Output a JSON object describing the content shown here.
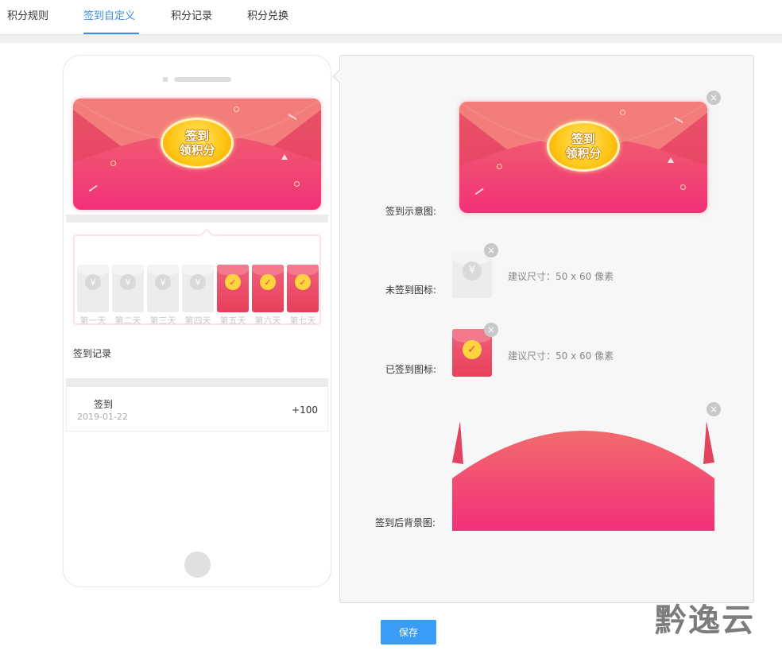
{
  "tabs": [
    {
      "label": "积分规则",
      "active": false
    },
    {
      "label": "签到自定义",
      "active": true
    },
    {
      "label": "积分记录",
      "active": false
    },
    {
      "label": "积分兑换",
      "active": false
    }
  ],
  "banner": {
    "line1": "签到",
    "line2": "领积分"
  },
  "days": [
    {
      "label": "第一天",
      "checked": false
    },
    {
      "label": "第二天",
      "checked": false
    },
    {
      "label": "第三天",
      "checked": false
    },
    {
      "label": "第四天",
      "checked": false
    },
    {
      "label": "第五天",
      "checked": true
    },
    {
      "label": "第六天",
      "checked": true
    },
    {
      "label": "第七天",
      "checked": true
    }
  ],
  "day_icons": {
    "unchecked": "¥",
    "checked": "✓"
  },
  "records": {
    "title": "签到记录",
    "items": [
      {
        "name": "签到",
        "date": "2019-01-22",
        "points": "+100"
      }
    ]
  },
  "settings": {
    "preview_label": "签到示意图:",
    "unchecked_label": "未签到图标:",
    "checked_label": "已签到图标:",
    "bg_label": "签到后背景图:",
    "size_hint": "建议尺寸：50 x 60 像素",
    "close_glyph": "×"
  },
  "save_label": "保存",
  "watermark": "黔逸云",
  "colors": {
    "accent": "#3a8ee6",
    "button": "#3a9df5",
    "red": "#f04a72",
    "gold": "#ffc81a"
  }
}
